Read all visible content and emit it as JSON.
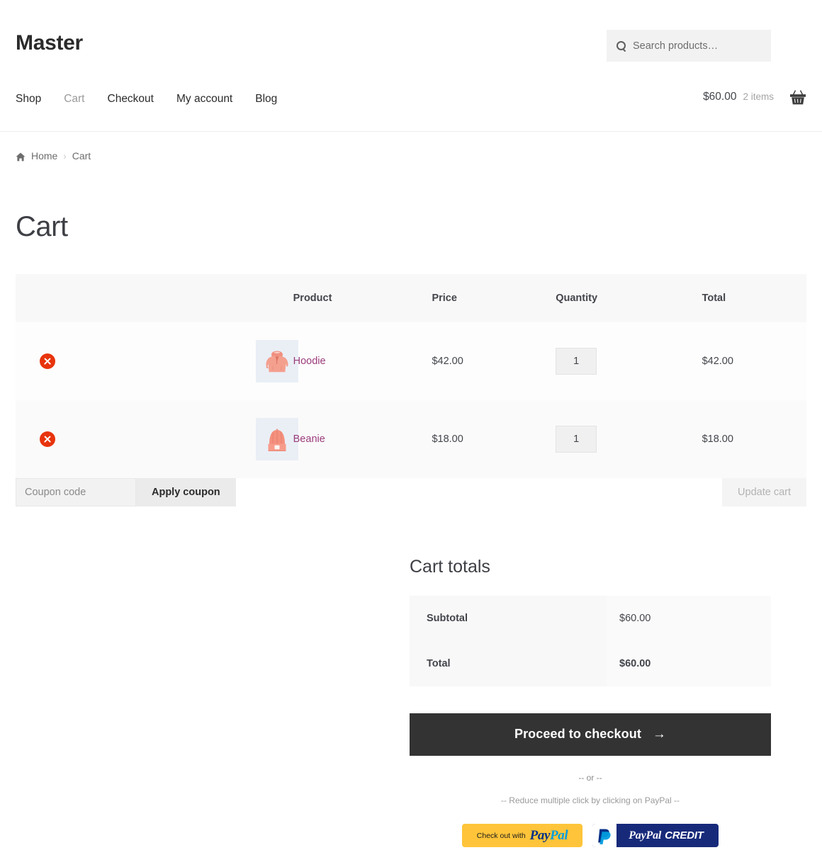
{
  "header": {
    "site_title": "Master",
    "search": {
      "placeholder": "Search products…",
      "value": "",
      "icon": "search-icon"
    },
    "nav": [
      {
        "label": "Shop",
        "current": false
      },
      {
        "label": "Cart",
        "current": true
      },
      {
        "label": "Checkout",
        "current": false
      },
      {
        "label": "My account",
        "current": false
      },
      {
        "label": "Blog",
        "current": false
      }
    ],
    "cart_widget": {
      "amount": "$60.00",
      "count": "2 items",
      "icon": "shopping-basket-icon"
    }
  },
  "breadcrumb": {
    "home_icon": "home-icon",
    "home_label": "Home",
    "separator": "›",
    "current": "Cart"
  },
  "page": {
    "title": "Cart"
  },
  "cart_table": {
    "columns": [
      "",
      "",
      "Product",
      "Price",
      "Quantity",
      "Total"
    ],
    "headers": {
      "product": "Product",
      "price": "Price",
      "quantity": "Quantity",
      "total": "Total"
    },
    "rows": [
      {
        "remove_icon": "remove-item-icon",
        "thumb_alt": "Hoodie",
        "name": "Hoodie",
        "price": "$42.00",
        "quantity": "1",
        "total": "$42.00"
      },
      {
        "remove_icon": "remove-item-icon",
        "thumb_alt": "Beanie",
        "name": "Beanie",
        "price": "$18.00",
        "quantity": "1",
        "total": "$18.00"
      }
    ]
  },
  "cart_actions": {
    "coupon_placeholder": "Coupon code",
    "coupon_value": "",
    "apply_coupon_label": "Apply coupon",
    "update_cart_label": "Update cart"
  },
  "totals": {
    "title": "Cart totals",
    "rows": [
      {
        "label": "Subtotal",
        "value": "$60.00"
      },
      {
        "label": "Total",
        "value": "$60.00"
      }
    ],
    "checkout_label": "Proceed to checkout",
    "checkout_arrow": "→"
  },
  "paypal": {
    "or_text": "-- or --",
    "note": "-- Reduce multiple click by clicking on PayPal --",
    "checkout_prefix": "Check out with",
    "wordmark_pay": "Pay",
    "wordmark_pal": "Pal",
    "credit_wordmark_pay": "Pay",
    "credit_wordmark_pal": "Pal",
    "credit_label": "CREDIT"
  },
  "colors": {
    "accent_dark": "#333333",
    "remove_red": "#e8340c",
    "product_link": "#9b3c7b",
    "paypal_yellow": "#ffc439",
    "paypal_blue": "#172a7a",
    "paypal_pay": "#003087",
    "paypal_pal": "#009cde"
  }
}
